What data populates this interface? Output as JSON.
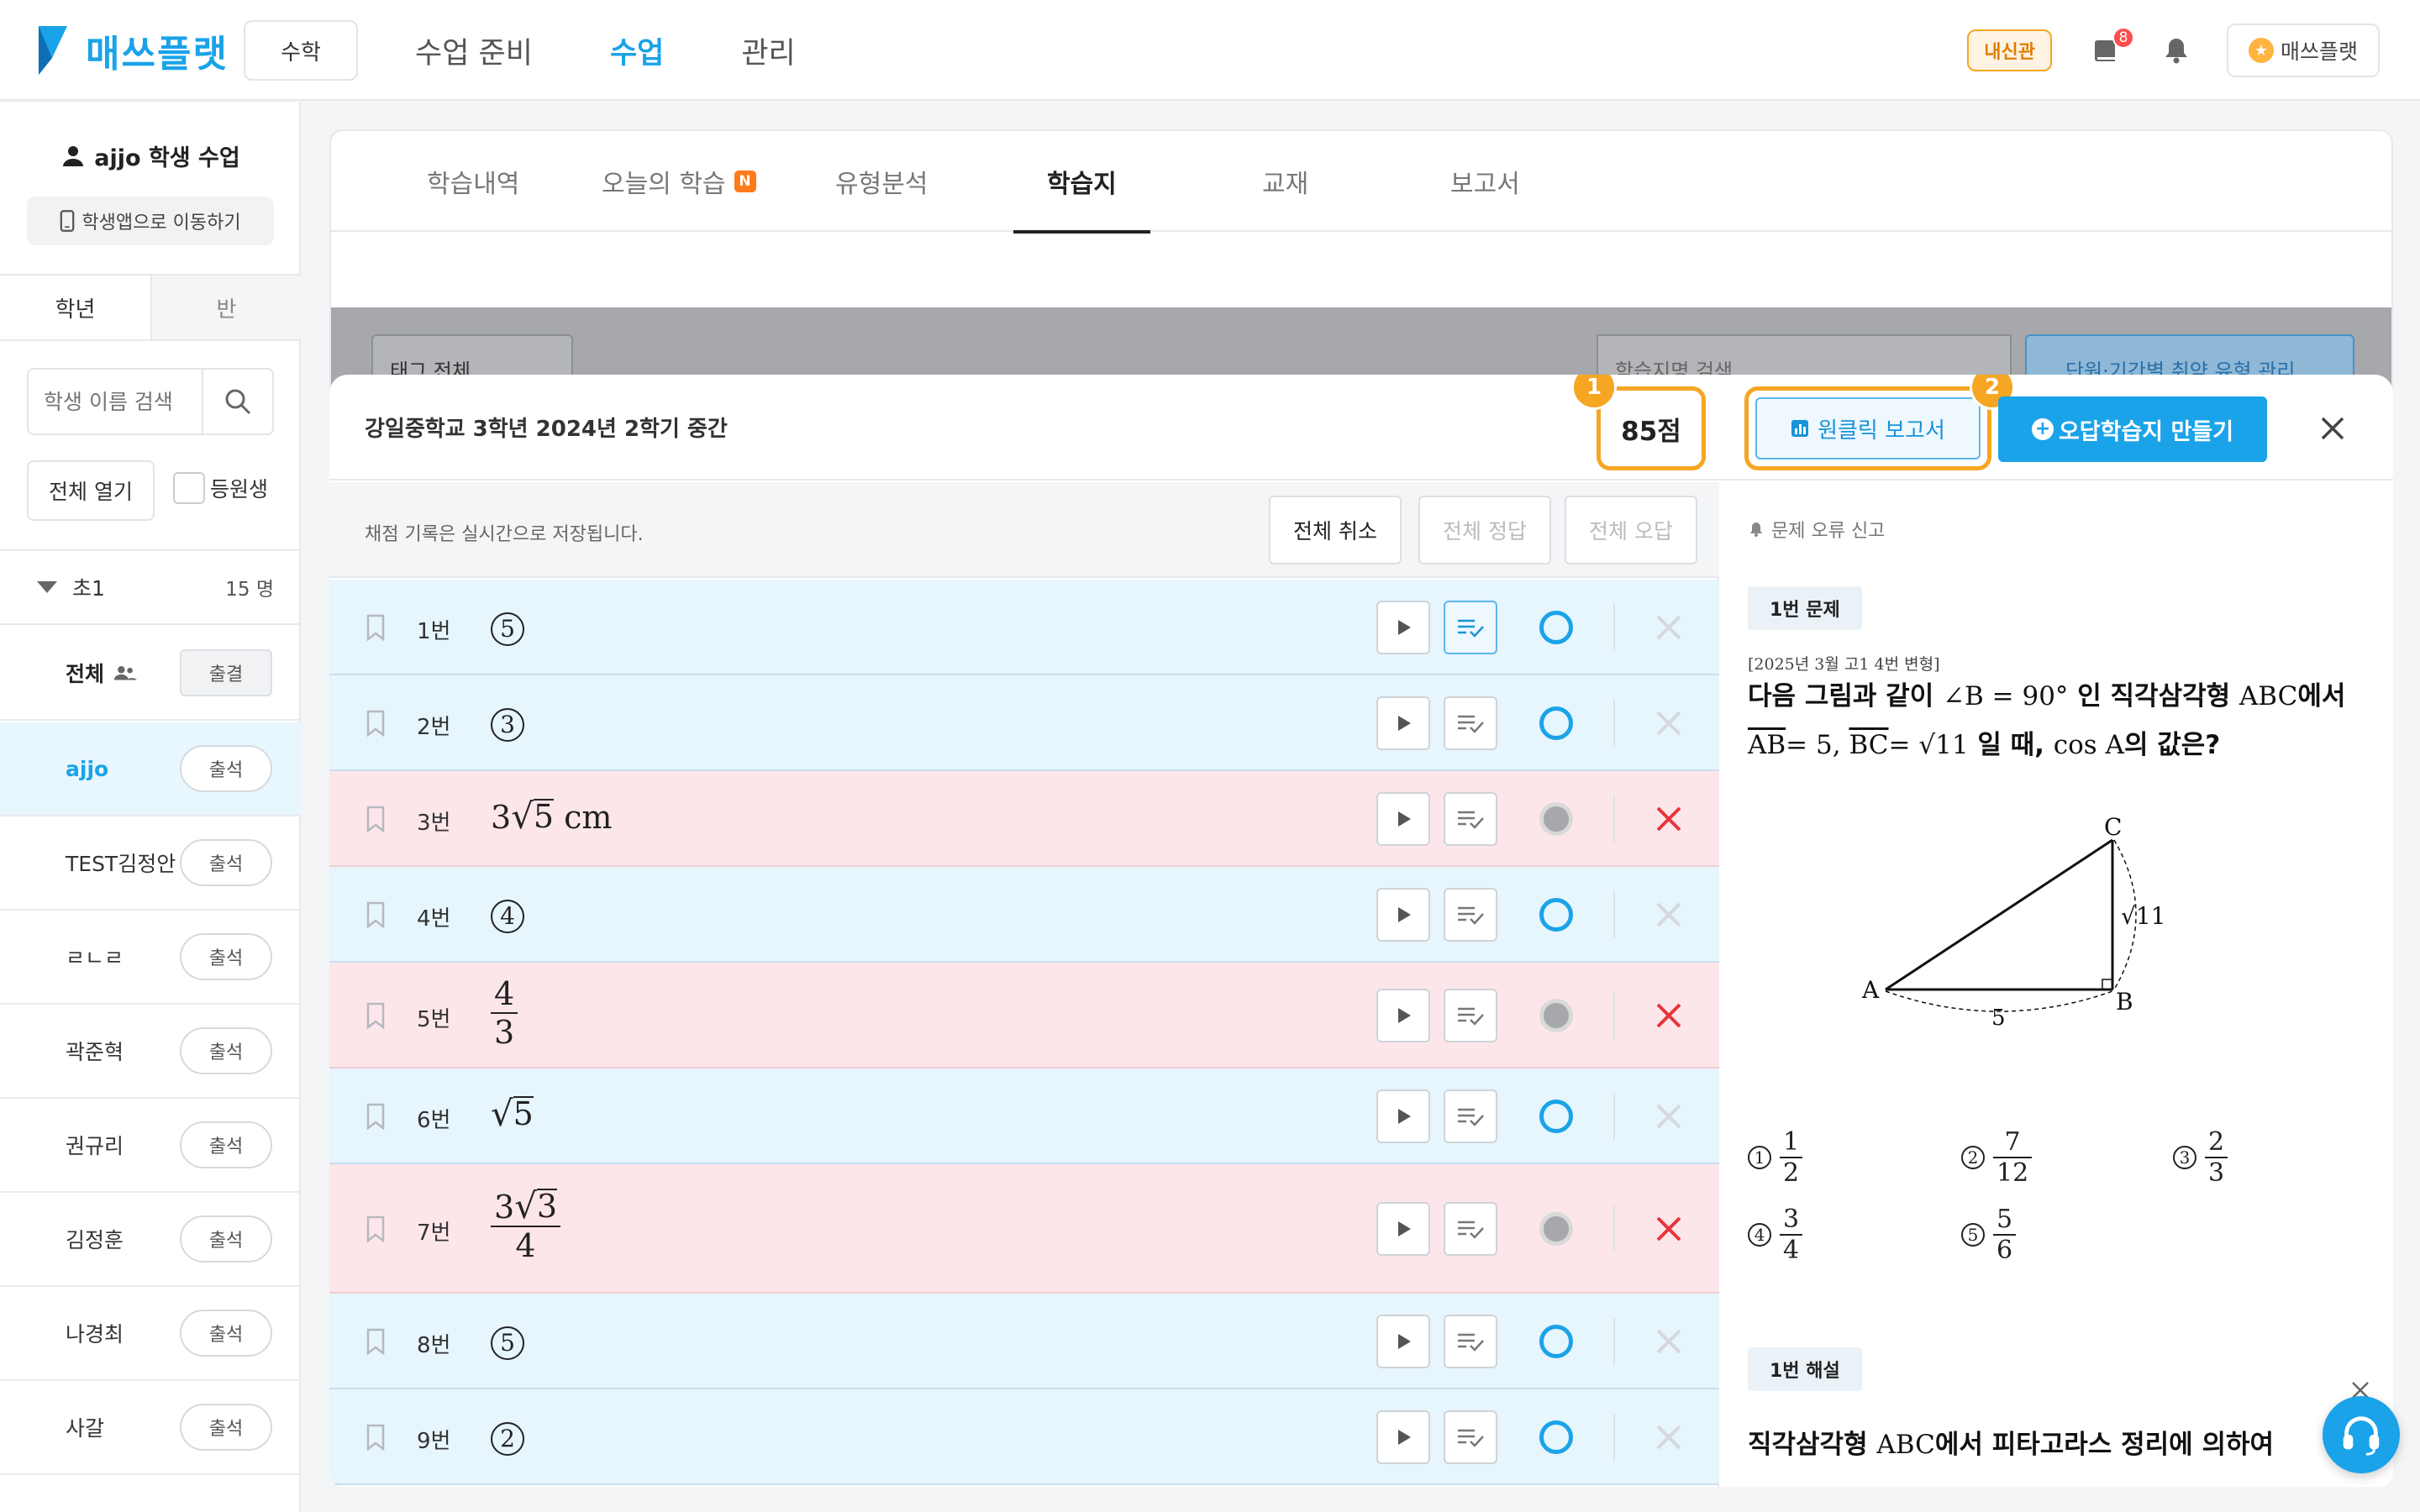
{
  "header": {
    "logo_text": "매쓰플랫",
    "subject": "수학",
    "nav": [
      "수업 준비",
      "수업",
      "관리"
    ],
    "active_nav": "수업",
    "naesin_label": "내신관",
    "notification_count": "8",
    "profile_label": "매쓰플랫",
    "brand_color": "#1aa3e8"
  },
  "sidebar": {
    "title": "ajjo 학생 수업",
    "move_button": "학생앱으로 이동하기",
    "tabs": [
      "학년",
      "반"
    ],
    "search_placeholder": "학생 이름 검색",
    "open_all": "전체 열기",
    "enrolled_label": "등원생",
    "group_name": "초1",
    "group_count": "15 명",
    "all_row": {
      "name": "전체",
      "button": "출결"
    },
    "students": [
      {
        "name": "ajjo",
        "button": "출석",
        "active": true
      },
      {
        "name": "TEST김정안",
        "button": "출석"
      },
      {
        "name": "ㄹㄴㄹ",
        "button": "출석"
      },
      {
        "name": "곽준혁",
        "button": "출석"
      },
      {
        "name": "권규리",
        "button": "출석"
      },
      {
        "name": "김정훈",
        "button": "출석"
      },
      {
        "name": "나경최",
        "button": "출석"
      },
      {
        "name": "사갈",
        "button": "출석"
      }
    ]
  },
  "main": {
    "tabs": [
      "학습내역",
      "오늘의 학습",
      "유형분석",
      "학습지",
      "교재",
      "보고서"
    ],
    "active_tab": "학습지",
    "new_badge": "N",
    "tag_filter": "태그 전체",
    "worksheet_search_placeholder": "학습지명 검색",
    "weak_type_button": "단원·기간별 취약 유형 관리"
  },
  "modal": {
    "title": "강일중학교 3학년 2024년 2학기 중간",
    "score": "85점",
    "marker_1": "1",
    "marker_2": "2",
    "oneclick_report": "원클릭 보고서",
    "make_wrong_sheet": "오답학습지 만들기",
    "save_note": "채점 기록은 실시간으로 저장됩니다.",
    "cancel_all": "전체 취소",
    "all_correct": "전체 정답",
    "all_wrong": "전체 오답",
    "questions": [
      {
        "no": "1번",
        "answer": "⑤",
        "result": "correct"
      },
      {
        "no": "2번",
        "answer": "③",
        "result": "correct"
      },
      {
        "no": "3번",
        "answer": "3√5 cm",
        "result": "wrong"
      },
      {
        "no": "4번",
        "answer": "④",
        "result": "correct"
      },
      {
        "no": "5번",
        "answer": "4/3",
        "result": "wrong"
      },
      {
        "no": "6번",
        "answer": "√5",
        "result": "correct"
      },
      {
        "no": "7번",
        "answer": "3√3/4",
        "result": "wrong"
      },
      {
        "no": "8번",
        "answer": "⑤",
        "result": "correct"
      },
      {
        "no": "9번",
        "answer": "②",
        "result": "correct"
      }
    ]
  },
  "problem": {
    "report_error": "문제 오류 신고",
    "problem_tag": "1번 문제",
    "source": "[2025년 3월 고1 4번 변형]",
    "text_line1_a": "다음 그림과 같이 ",
    "text_line1_math": "∠B = 90°",
    "text_line1_b": " 인 직각삼각형 ",
    "text_line1_math2": "ABC",
    "text_line1_c": "에서",
    "text_line2_a": "AB",
    "text_line2_b": "= 5, ",
    "text_line2_c": "BC",
    "text_line2_d": "= √11",
    "text_line2_e": " 일 때, ",
    "text_line2_f": "cos A",
    "text_line2_g": "의 값은?",
    "figure_labels": {
      "A": "A",
      "B": "B",
      "C": "C",
      "base": "5",
      "height": "√11"
    },
    "choices": [
      {
        "num": "1",
        "n": "1",
        "d": "2"
      },
      {
        "num": "2",
        "n": "7",
        "d": "12"
      },
      {
        "num": "3",
        "n": "2",
        "d": "3"
      },
      {
        "num": "4",
        "n": "3",
        "d": "4"
      },
      {
        "num": "5",
        "n": "5",
        "d": "6"
      }
    ],
    "solution_tag": "1번 해설",
    "solution_a": "직각삼각형 ",
    "solution_math": "ABC",
    "solution_b": "에서 피타고라스 정리에 의하여"
  },
  "colors": {
    "correct_row": "#e7f5fd",
    "wrong_row": "#fde6ea",
    "highlight": "#f6a623",
    "wrong_mark": "#e8343a"
  }
}
